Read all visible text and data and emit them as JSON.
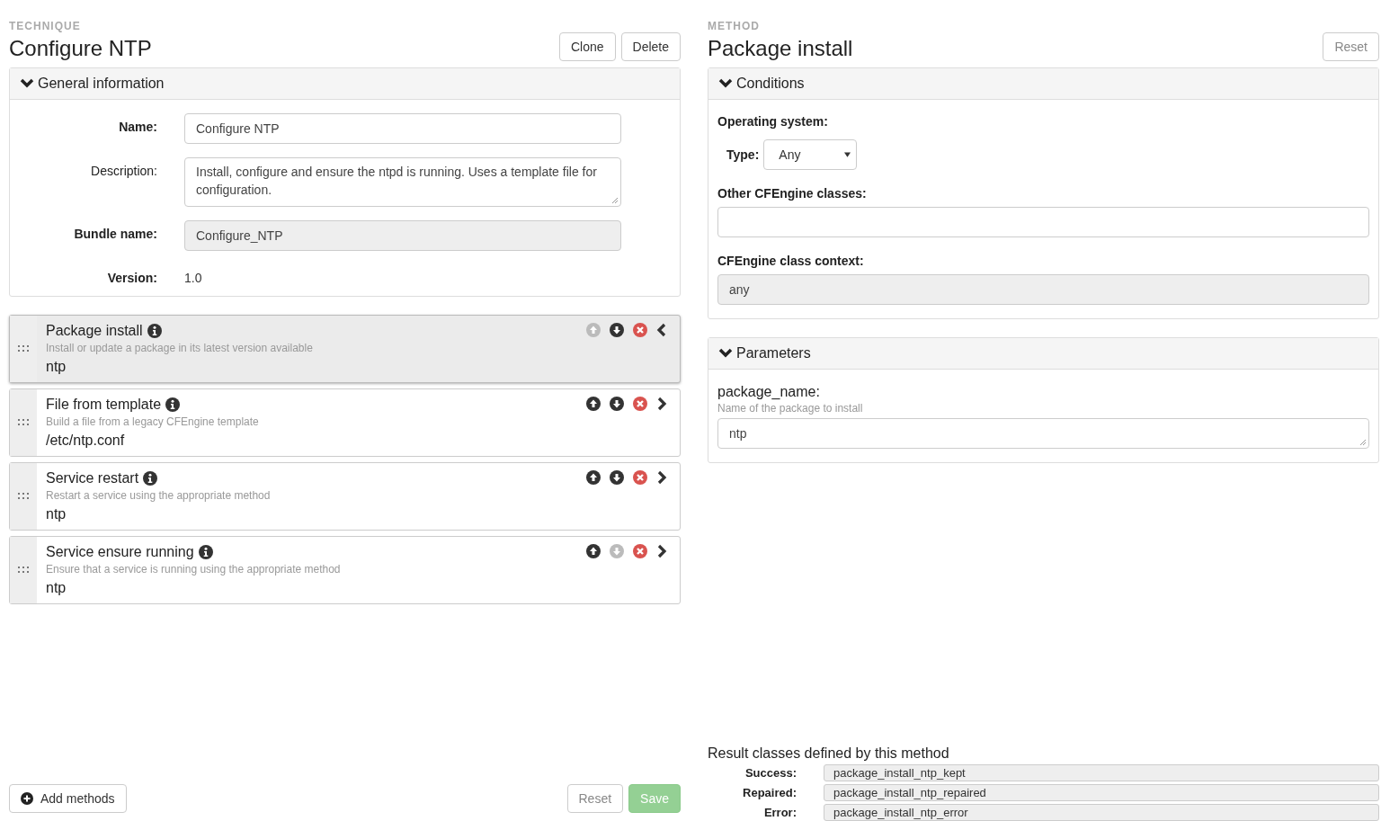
{
  "technique": {
    "eyebrow": "TECHNIQUE",
    "title": "Configure NTP",
    "buttons": [
      "Clone",
      "Delete"
    ],
    "general": {
      "heading": "General information",
      "expanded": true,
      "fields": [
        {
          "kind": "input",
          "label": "Name:",
          "value": "Configure NTP"
        },
        {
          "kind": "textarea",
          "label": "Description:",
          "value": "Install, configure and ensure the ntpd is running. Uses a template file for configuration."
        },
        {
          "kind": "readonly",
          "label": "Bundle name:",
          "value": "Configure_NTP"
        },
        {
          "kind": "text",
          "label": "Version:",
          "value": "1.0"
        }
      ]
    },
    "methods": [
      {
        "name": "Package install",
        "description": "Install or update a package in its latest version available",
        "parameter": "ntp",
        "selected": true,
        "up_disabled": true,
        "down_disabled": false
      },
      {
        "name": "File from template",
        "description": "Build a file from a legacy CFEngine template",
        "parameter": "/etc/ntp.conf",
        "selected": false,
        "up_disabled": false,
        "down_disabled": false
      },
      {
        "name": "Service restart",
        "description": "Restart a service using the appropriate method",
        "parameter": "ntp",
        "selected": false,
        "up_disabled": false,
        "down_disabled": false
      },
      {
        "name": "Service ensure running",
        "description": "Ensure that a service is running using the appropriate method",
        "parameter": "ntp",
        "selected": false,
        "up_disabled": false,
        "down_disabled": true
      }
    ],
    "add_button": "Add methods",
    "reset_button": "Reset",
    "save_button": {
      "label": "Save",
      "disabled": true
    }
  },
  "method": {
    "eyebrow": "METHOD",
    "title": "Package install",
    "reset_button": "Reset",
    "conditions": {
      "heading": "Conditions",
      "expanded": true,
      "os_label": "Operating system:",
      "type_label": "Type:",
      "type_value": "Any",
      "other_label": "Other CFEngine classes:",
      "context_label": "CFEngine class context:",
      "context_value": "any"
    },
    "parameters": {
      "heading": "Parameters",
      "expanded": true,
      "items": [
        {
          "name": "package_name:",
          "hint": "Name of the package to install",
          "value": "ntp"
        }
      ]
    },
    "results": {
      "heading": "Result classes defined by this method",
      "rows": [
        {
          "label": "Success:",
          "value": "package_install_ntp_kept"
        },
        {
          "label": "Repaired:",
          "value": "package_install_ntp_repaired"
        },
        {
          "label": "Error:",
          "value": "package_install_ntp_error"
        }
      ]
    }
  }
}
